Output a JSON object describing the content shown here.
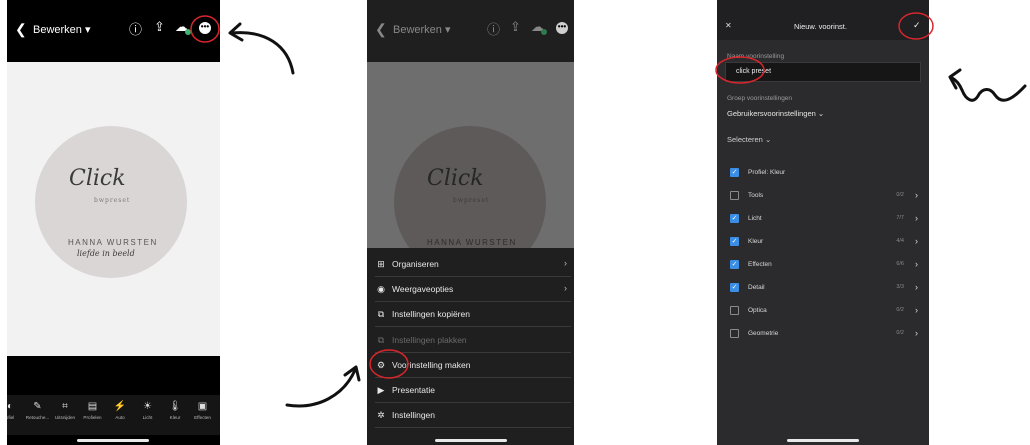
{
  "phone1": {
    "back_icon": "chevron-left-icon",
    "title": "Bewerken",
    "caret": "▾",
    "logo": {
      "script": "Click",
      "sub": "bwpreset",
      "name": "HANNA WURSTEN",
      "tagline": "liefde in beeld"
    },
    "tools": [
      {
        "icon": "profile-icon",
        "label": "ofiel"
      },
      {
        "icon": "healing-icon",
        "label": "Retouche..."
      },
      {
        "icon": "crop-icon",
        "label": "Uitsnijden"
      },
      {
        "icon": "profiles-icon",
        "label": "Profielen"
      },
      {
        "icon": "auto-icon",
        "label": "Auto"
      },
      {
        "icon": "light-icon",
        "label": "Licht"
      },
      {
        "icon": "color-icon",
        "label": "Kleur"
      },
      {
        "icon": "effects-icon",
        "label": "Effecten"
      }
    ]
  },
  "phone2": {
    "title": "Bewerken",
    "caret": "▾",
    "menu": [
      {
        "icon": "organize-icon",
        "label": "Organiseren",
        "arrow": "›"
      },
      {
        "icon": "view-options-icon",
        "label": "Weergaveopties",
        "arrow": "›"
      },
      {
        "icon": "copy-settings-icon",
        "label": "Instellingen kopiëren",
        "arrow": ""
      },
      {
        "icon": "paste-settings-icon",
        "label": "Instellingen plakken",
        "arrow": ""
      },
      {
        "icon": "create-preset-icon",
        "label": "Voorinstelling maken",
        "arrow": ""
      },
      {
        "icon": "play-icon",
        "label": "Presentatie",
        "arrow": ""
      },
      {
        "icon": "gear-icon",
        "label": "Instellingen",
        "arrow": ""
      }
    ]
  },
  "phone3": {
    "close": "✕",
    "title": "Nieuw. voorinst.",
    "confirm": "✓",
    "name_label": "Naam voorinstelling",
    "name_value": "click preset",
    "group_label": "Groep voorinstellingen",
    "group_value": "Gebruikersvoorinstellingen",
    "select_label": "Selecteren",
    "items": [
      {
        "label": "Profiel: Kleur",
        "checked": true,
        "count": ""
      },
      {
        "label": "Tools",
        "checked": false,
        "count": "0/2"
      },
      {
        "label": "Licht",
        "checked": true,
        "count": "7/7"
      },
      {
        "label": "Kleur",
        "checked": true,
        "count": "4/4"
      },
      {
        "label": "Effecten",
        "checked": true,
        "count": "6/6"
      },
      {
        "label": "Detail",
        "checked": true,
        "count": "3/3"
      },
      {
        "label": "Optica",
        "checked": false,
        "count": "0/2"
      },
      {
        "label": "Geometrie",
        "checked": false,
        "count": "0/2"
      }
    ]
  },
  "colors": {
    "annotation_red": "#d8262c",
    "checkbox_blue": "#3a8ee6",
    "cloud_green": "#3cb371"
  }
}
